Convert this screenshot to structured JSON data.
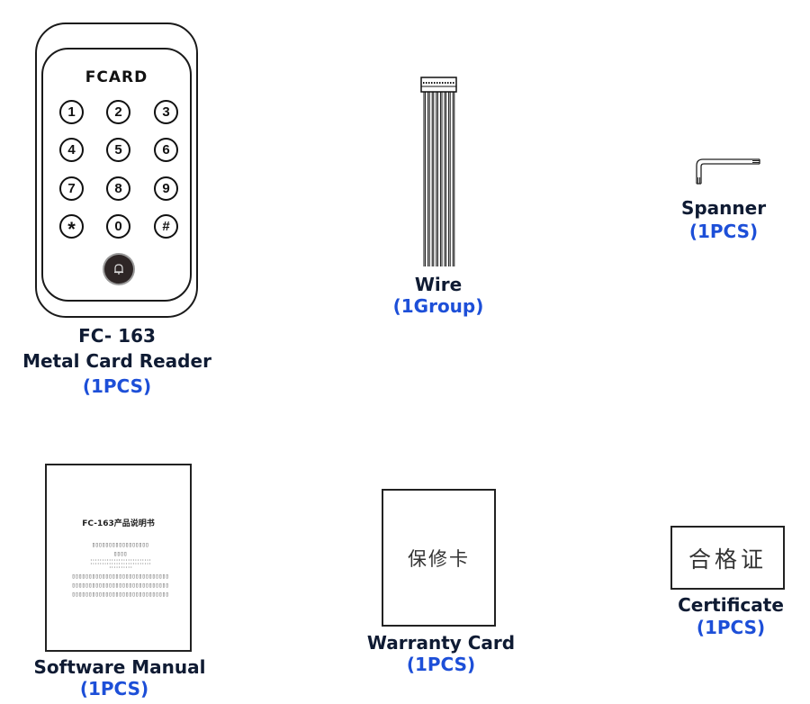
{
  "items": [
    {
      "id": "card-reader",
      "brand": "FCARD",
      "keys": [
        "1",
        "2",
        "3",
        "4",
        "5",
        "6",
        "7",
        "8",
        "9",
        "*",
        "0",
        "#"
      ],
      "bell_icon": "bell-icon",
      "model": "FC- 163",
      "name": "Metal Card Reader",
      "qty": "(1PCS)"
    },
    {
      "id": "wire",
      "name": "Wire",
      "qty": "(1Group)",
      "wire_count": 8
    },
    {
      "id": "spanner",
      "name": "Spanner",
      "qty": "(1PCS)"
    },
    {
      "id": "manual",
      "cover_title": "FC-163产品说明书",
      "name": "Software Manual",
      "qty": "(1PCS)"
    },
    {
      "id": "warranty-card",
      "cover_text": "保修卡",
      "name": "Warranty Card",
      "qty": "(1PCS)"
    },
    {
      "id": "certificate",
      "cover_text": "合格证",
      "name": "Certificate",
      "qty": "(1PCS)"
    }
  ],
  "colors": {
    "name_text": "#0f1b33",
    "qty_text": "#1d4fd8",
    "outline": "#1a1a1a"
  }
}
